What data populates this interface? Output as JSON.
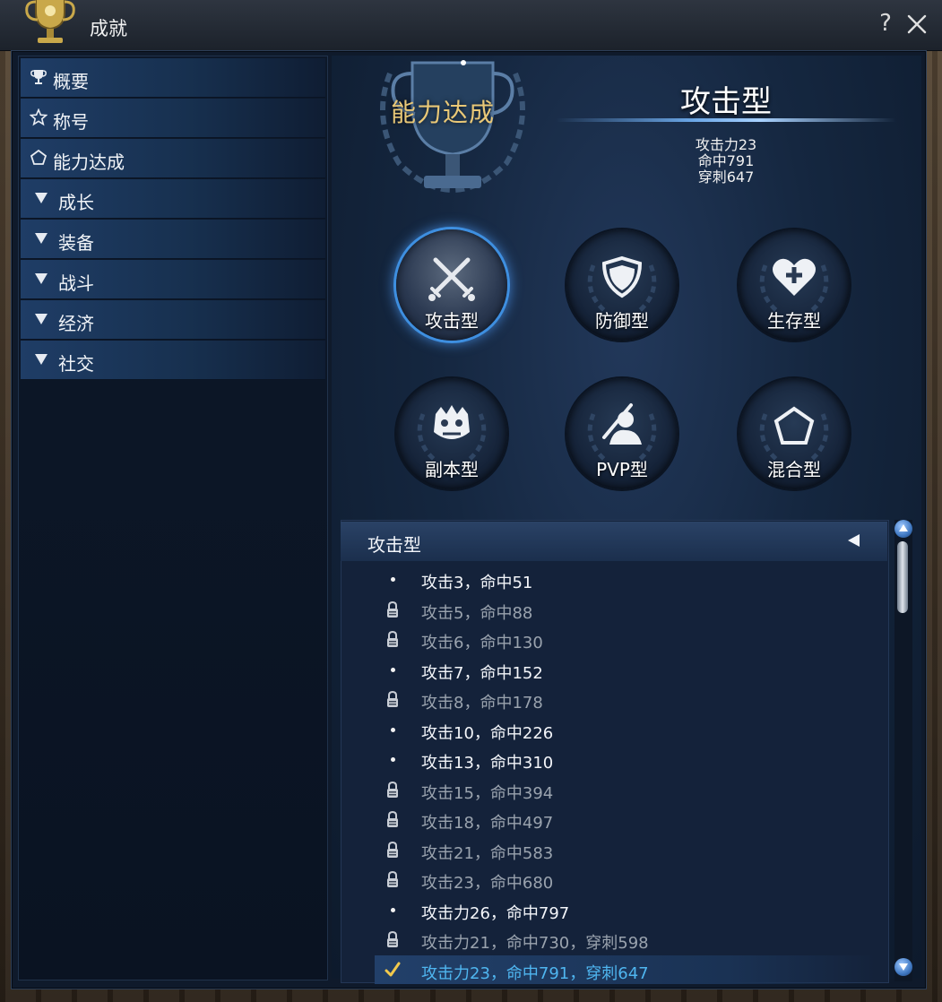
{
  "window": {
    "title": "成就",
    "help_label": "?",
    "icon": "trophy-icon"
  },
  "sidebar": {
    "items": [
      {
        "label": "概要",
        "icon": "trophy-small-icon"
      },
      {
        "label": "称号",
        "icon": "star-outline-icon"
      },
      {
        "label": "能力达成",
        "icon": "pentagon-outline-icon"
      },
      {
        "label": "成长",
        "icon": "triangle-down-icon"
      },
      {
        "label": "装备",
        "icon": "triangle-down-icon"
      },
      {
        "label": "战斗",
        "icon": "triangle-down-icon"
      },
      {
        "label": "经济",
        "icon": "triangle-down-icon"
      },
      {
        "label": "社交",
        "icon": "triangle-down-icon"
      }
    ]
  },
  "header": {
    "category": "能力达成",
    "type_title": "攻击型",
    "stats": [
      "攻击力23",
      "命中791",
      "穿刺647"
    ]
  },
  "types": [
    {
      "label": "攻击型",
      "icon": "crossed-swords-icon",
      "active": true
    },
    {
      "label": "防御型",
      "icon": "shield-icon",
      "active": false
    },
    {
      "label": "生存型",
      "icon": "heart-plus-icon",
      "active": false
    },
    {
      "label": "副本型",
      "icon": "monster-face-icon",
      "active": false
    },
    {
      "label": "PVP型",
      "icon": "pvp-figure-icon",
      "active": false
    },
    {
      "label": "混合型",
      "icon": "pentagon-icon",
      "active": false
    }
  ],
  "list": {
    "header": "攻击型",
    "rows": [
      {
        "text": "攻击3，命中51",
        "state": "open"
      },
      {
        "text": "攻击5，命中88",
        "state": "locked"
      },
      {
        "text": "攻击6，命中130",
        "state": "locked"
      },
      {
        "text": "攻击7，命中152",
        "state": "open"
      },
      {
        "text": "攻击8，命中178",
        "state": "locked"
      },
      {
        "text": "攻击10，命中226",
        "state": "open"
      },
      {
        "text": "攻击13，命中310",
        "state": "open"
      },
      {
        "text": "攻击15，命中394",
        "state": "locked"
      },
      {
        "text": "攻击18，命中497",
        "state": "locked"
      },
      {
        "text": "攻击21，命中583",
        "state": "locked"
      },
      {
        "text": "攻击23，命中680",
        "state": "locked"
      },
      {
        "text": "攻击力26，命中797",
        "state": "open"
      },
      {
        "text": "攻击力21，命中730，穿刺598",
        "state": "locked"
      },
      {
        "text": "攻击力23，命中791，穿刺647",
        "state": "done"
      }
    ]
  },
  "colors": {
    "accent_blue": "#3e8fe0",
    "gold": "#e9c877",
    "done_text": "#4fb6f0"
  }
}
